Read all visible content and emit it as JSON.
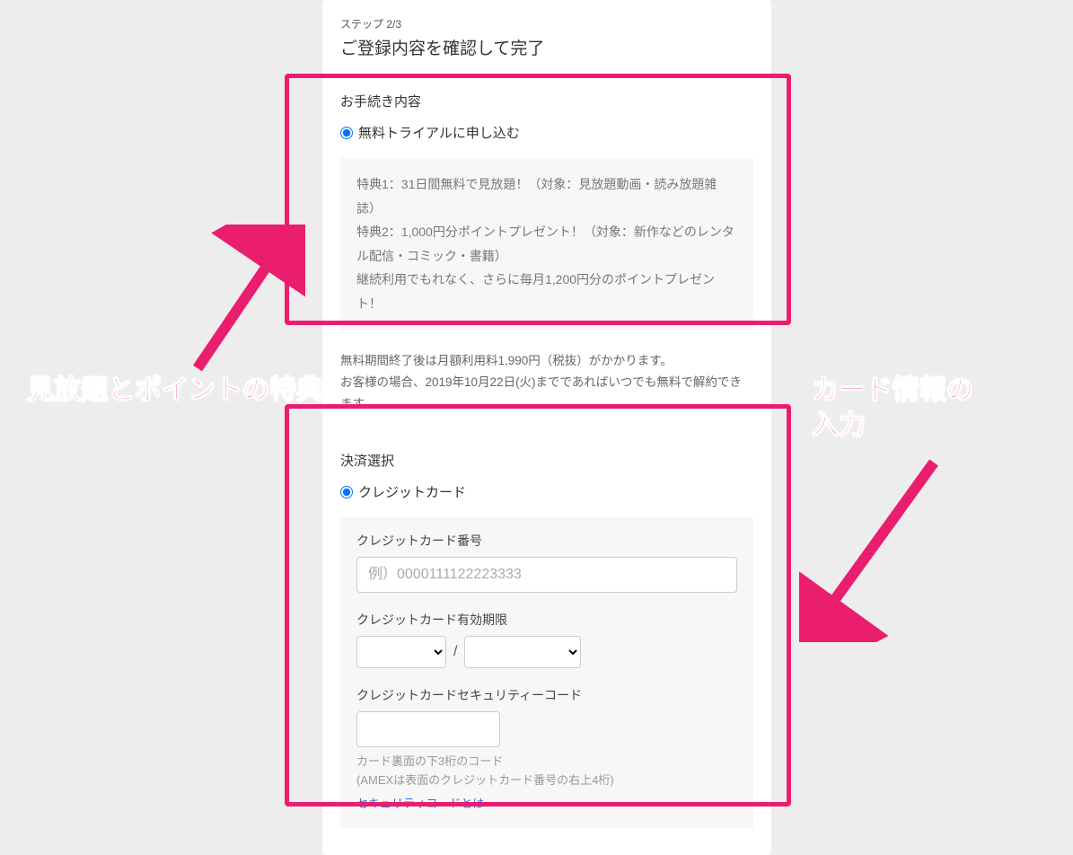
{
  "step": "ステップ 2/3",
  "title": "ご登録内容を確認して完了",
  "procedure": {
    "heading": "お手続き内容",
    "radio_label": "無料トライアルに申し込む",
    "benefits": "特典1：31日間無料で見放題！（対象：見放題動画・読み放題雑誌）\n特典2：1,000円分ポイントプレゼント！（対象：新作などのレンタル配信・コミック・書籍）\n継続利用でもれなく、さらに毎月1,200円分のポイントプレゼント！",
    "note": "無料期間終了後は月額利用料1,990円（税抜）がかかります。\nお客様の場合、2019年10月22日(火)までであればいつでも無料で解約できます。"
  },
  "payment": {
    "heading": "決済選択",
    "radio_label": "クレジットカード",
    "card_number_label": "クレジットカード番号",
    "card_number_placeholder": "例）0000111122223333",
    "expiry_label": "クレジットカード有効期限",
    "slash": "/",
    "security_label": "クレジットカードセキュリティーコード",
    "security_hint": "カード裏面の下3桁のコード\n(AMEXは表面のクレジットカード番号の右上4桁)",
    "security_link": "セキュリティコードとは"
  },
  "annotations": {
    "left": "見放題とポイントの特典",
    "right": "カード情報の\n入力"
  }
}
